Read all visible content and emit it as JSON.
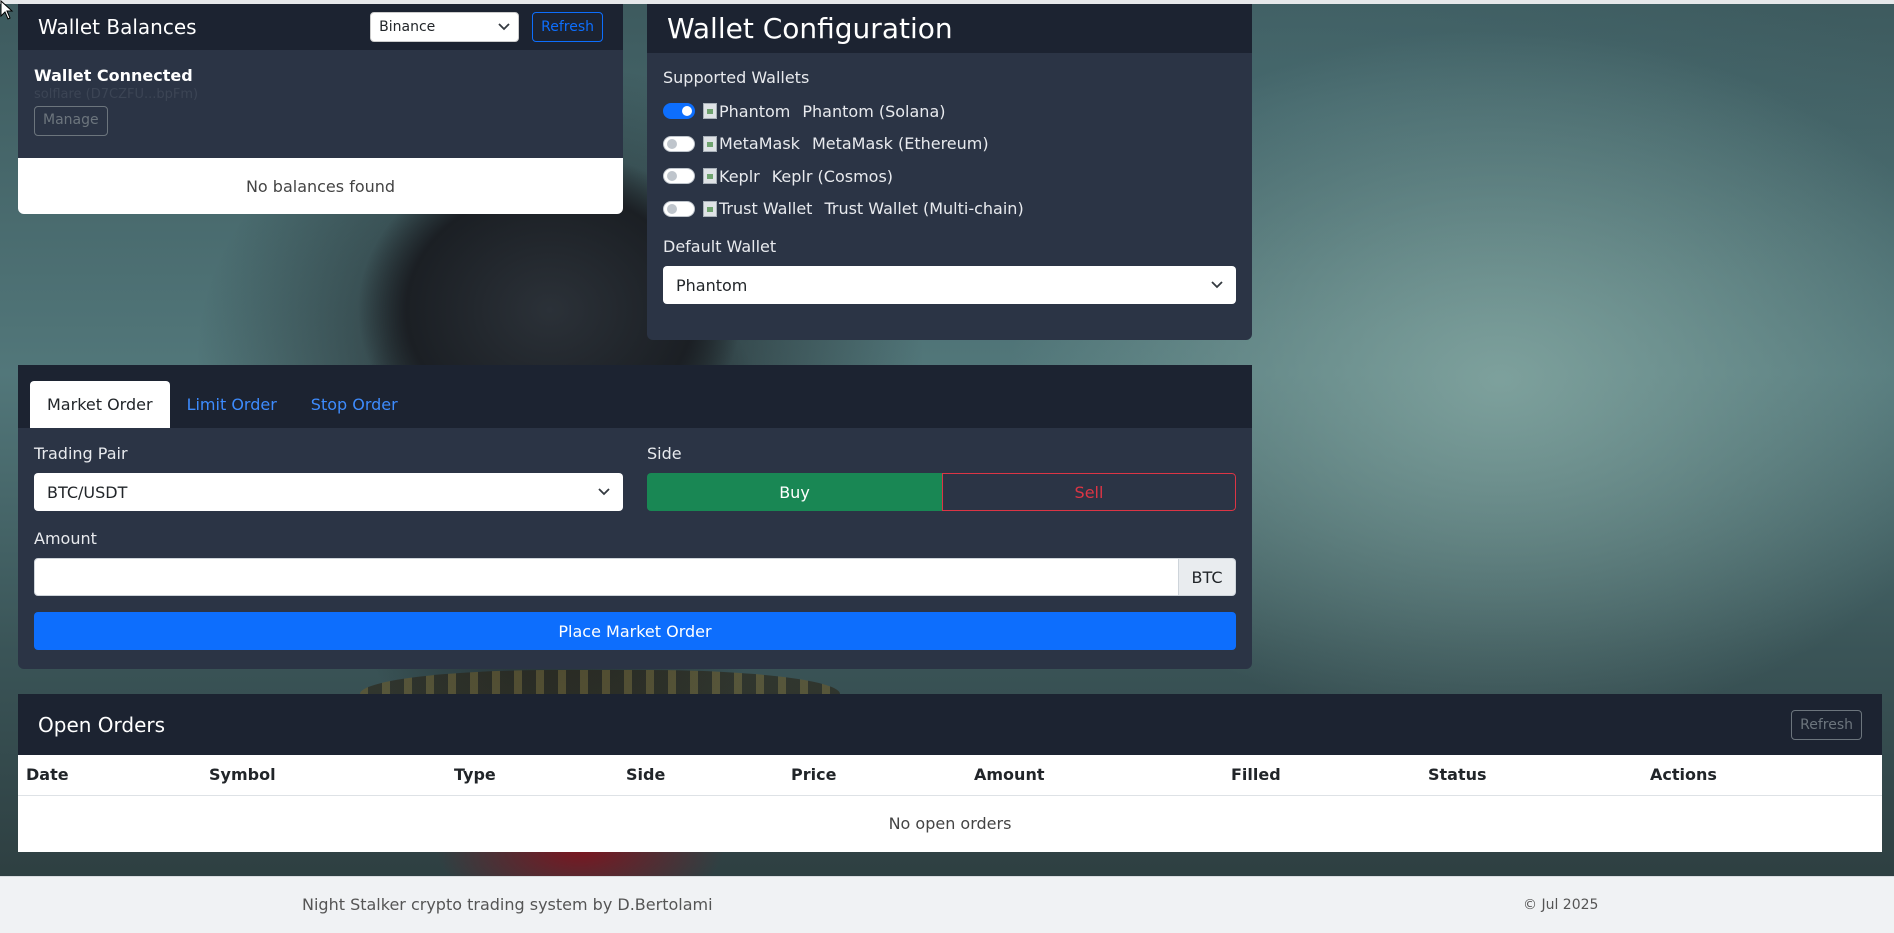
{
  "wallet_balances": {
    "title": "Wallet Balances",
    "exchange_selected": "Binance",
    "refresh_label": "Refresh",
    "connected_title": "Wallet Connected",
    "connected_address": "solflare (D7CZFU...bpFm)",
    "manage_label": "Manage",
    "empty_text": "No balances found"
  },
  "wallet_config": {
    "title": "Wallet Configuration",
    "supported_label": "Supported Wallets",
    "wallets": [
      {
        "img_alt": "Phantom",
        "label": "Phantom (Solana)",
        "enabled": true
      },
      {
        "img_alt": "MetaMask",
        "label": "MetaMask (Ethereum)",
        "enabled": false
      },
      {
        "img_alt": "Keplr",
        "label": "Keplr (Cosmos)",
        "enabled": false
      },
      {
        "img_alt": "Trust Wallet",
        "label": "Trust Wallet (Multi-chain)",
        "enabled": false
      }
    ],
    "default_label": "Default Wallet",
    "default_selected": "Phantom"
  },
  "order": {
    "tabs": [
      {
        "label": "Market Order",
        "active": true
      },
      {
        "label": "Limit Order",
        "active": false
      },
      {
        "label": "Stop Order",
        "active": false
      }
    ],
    "pair_label": "Trading Pair",
    "pair_selected": "BTC/USDT",
    "side_label": "Side",
    "buy_label": "Buy",
    "sell_label": "Sell",
    "amount_label": "Amount",
    "amount_value": "",
    "amount_unit": "BTC",
    "submit_label": "Place Market Order"
  },
  "open_orders": {
    "title": "Open Orders",
    "refresh_label": "Refresh",
    "columns": [
      "Date",
      "Symbol",
      "Type",
      "Side",
      "Price",
      "Amount",
      "Filled",
      "Status",
      "Actions"
    ],
    "empty_text": "No open orders"
  },
  "footer": {
    "credit": "Night Stalker crypto trading system by D.Bertolami",
    "copyright": "© Jul 2025"
  },
  "colors": {
    "card_header": "#1c2331",
    "card_body": "#2b3445",
    "primary": "#0d6efd",
    "buy": "#198754",
    "sell": "#dc3545"
  }
}
